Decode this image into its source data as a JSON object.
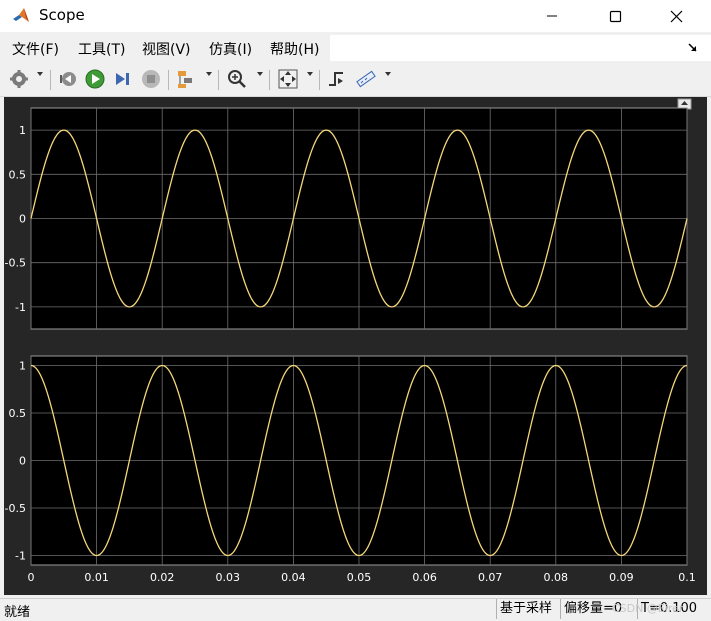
{
  "window": {
    "title": "Scope"
  },
  "menu": {
    "items": [
      "文件(F)",
      "工具(T)",
      "视图(V)",
      "仿真(I)",
      "帮助(H)"
    ]
  },
  "toolbar": {
    "icons": [
      "settings-icon",
      "step-back-icon",
      "run-icon",
      "step-forward-icon",
      "stop-icon",
      "signal-selector-icon",
      "zoom-icon",
      "autoscale-icon",
      "triggers-icon",
      "measurements-icon"
    ]
  },
  "status": {
    "left": "就绪",
    "mode": "基于采样",
    "offset": "偏移量=0",
    "time": "T=0.100",
    "watermark": "CSDN @Eirer"
  },
  "colors": {
    "signal": "#f5d77a",
    "plot_bg": "#000000",
    "frame_bg": "#262626",
    "grid": "#6e6e6e",
    "tick_text": "#ffffff"
  },
  "chart_data": [
    {
      "type": "line",
      "xlim": [
        0,
        0.1
      ],
      "ylim": [
        -1.25,
        1.25
      ],
      "yticks": [
        1,
        0.5,
        0,
        -0.5,
        -1
      ],
      "ytick_labels": [
        "1",
        "0.5",
        "0",
        "-0.5",
        "-1"
      ],
      "xticks": [
        0,
        0.01,
        0.02,
        0.03,
        0.04,
        0.05,
        0.06,
        0.07,
        0.08,
        0.09,
        0.1
      ],
      "show_xtick_labels": false,
      "grid": true,
      "series": [
        {
          "function": "sin",
          "amplitude": 1,
          "frequency": 50,
          "x_start": 0,
          "x_end": 0.1
        }
      ]
    },
    {
      "type": "line",
      "xlim": [
        0,
        0.1
      ],
      "ylim": [
        -1.1,
        1.1
      ],
      "yticks": [
        1,
        0.5,
        0,
        -0.5,
        -1
      ],
      "ytick_labels": [
        "1",
        "0.5",
        "0",
        "-0.5",
        "-1"
      ],
      "xticks": [
        0,
        0.01,
        0.02,
        0.03,
        0.04,
        0.05,
        0.06,
        0.07,
        0.08,
        0.09,
        0.1
      ],
      "xtick_labels": [
        "0",
        "0.01",
        "0.02",
        "0.03",
        "0.04",
        "0.05",
        "0.06",
        "0.07",
        "0.08",
        "0.09",
        "0.1"
      ],
      "show_xtick_labels": true,
      "grid": true,
      "series": [
        {
          "function": "cos",
          "amplitude": 1,
          "frequency": 50,
          "x_start": 0,
          "x_end": 0.1
        }
      ]
    }
  ]
}
